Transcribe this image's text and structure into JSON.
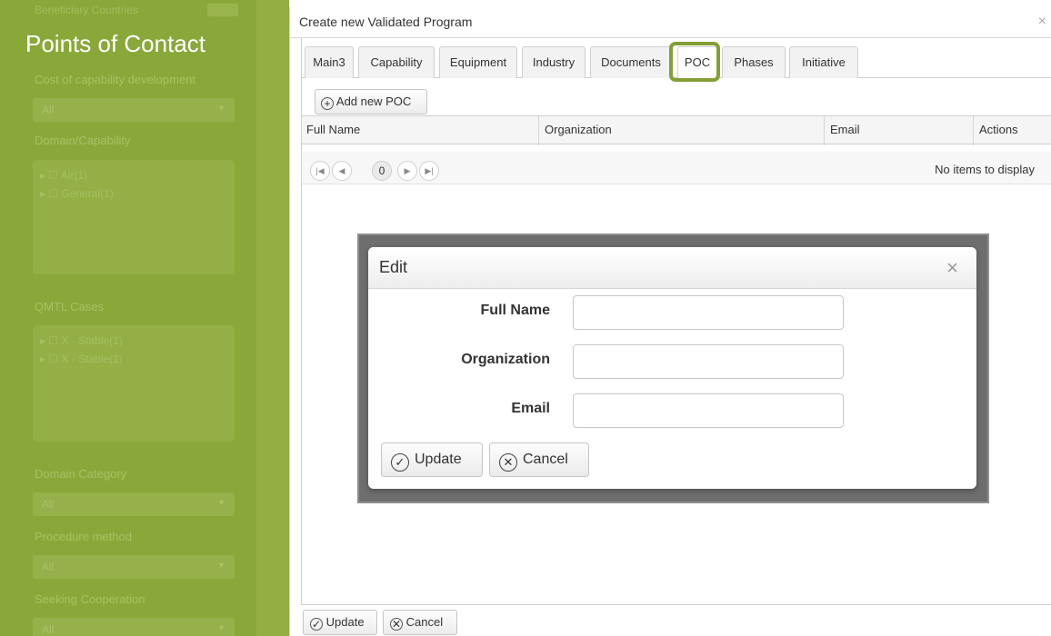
{
  "left_panel": {
    "header_text": "Beneficiary Countries",
    "title": "Points of Contact",
    "sections": [
      {
        "label": "Cost of capability development",
        "kind": "select",
        "value": "All"
      },
      {
        "label": "Domain/Capability",
        "kind": "tree",
        "items": [
          "Air(1)",
          "General(1)"
        ]
      },
      {
        "label": "QMTL Cases",
        "kind": "tree",
        "items": [
          "X - Stable(1)",
          "X - Stable(1)"
        ]
      },
      {
        "label": "Domain Category",
        "kind": "select",
        "value": "All"
      },
      {
        "label": "Procedure method",
        "kind": "select",
        "value": "All"
      },
      {
        "label": "Seeking Cooperation",
        "kind": "select",
        "value": "All"
      }
    ]
  },
  "window": {
    "title": "Create new Validated Program",
    "close_glyph": "×",
    "tabs": [
      {
        "label": "Main3",
        "active": false
      },
      {
        "label": "Capability",
        "active": false
      },
      {
        "label": "Equipment",
        "active": false
      },
      {
        "label": "Industry",
        "active": false
      },
      {
        "label": "Documents",
        "active": false
      },
      {
        "label": "POC",
        "active": true
      },
      {
        "label": "Phases",
        "active": false
      },
      {
        "label": "Initiative",
        "active": false
      }
    ],
    "add_button_label": "Add new POC",
    "grid": {
      "columns": [
        "Full Name",
        "Organization",
        "Email",
        "Actions"
      ],
      "pager": {
        "first": "|◀",
        "prev": "◀",
        "page": "0",
        "next": "▶",
        "last": "▶|"
      },
      "empty_message": "No items to display"
    },
    "footer": {
      "update_label": "Update",
      "cancel_label": "Cancel"
    }
  },
  "edit_popup": {
    "title": "Edit",
    "close_glyph": "×",
    "fields": [
      {
        "label": "Full Name",
        "value": "",
        "placeholder": ""
      },
      {
        "label": "Organization",
        "value": "",
        "placeholder": ""
      },
      {
        "label": "Email",
        "value": "",
        "placeholder": ""
      }
    ],
    "update_label": "Update",
    "cancel_label": "Cancel"
  },
  "colors": {
    "sidebar_green": "#8aa83a",
    "highlight_green": "#83a034",
    "overlay_gray": "#6e6e6e"
  },
  "icons": {
    "add": "plus-circle-icon",
    "update": "check-circle-icon",
    "cancel": "x-circle-icon"
  }
}
